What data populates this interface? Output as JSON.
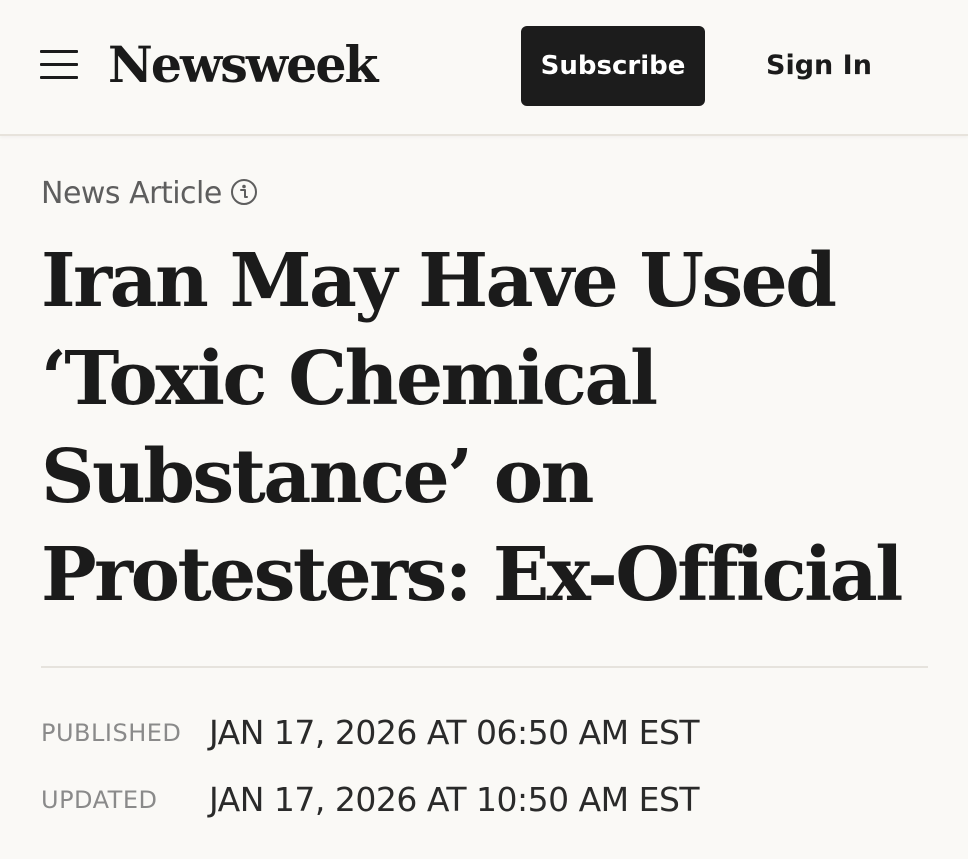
{
  "header": {
    "logo": "Newsweek",
    "subscribe_label": "Subscribe",
    "signin_label": "Sign In"
  },
  "article": {
    "kicker": "News Article",
    "headline_lines": [
      "Iran May Have Used",
      "‘Toxic Chemical",
      "Substance’ on",
      "Protesters: Ex-Official"
    ],
    "published_label": "PUBLISHED",
    "published_value": "JAN 17, 2026 AT 06:50 AM EST",
    "updated_label": "UPDATED",
    "updated_value": "JAN 17, 2026 AT 10:50 AM EST"
  },
  "icons": {
    "menu": "hamburger-menu-icon",
    "kicker_info": "info-circle-icon"
  },
  "colors": {
    "background": "#faf9f6",
    "text": "#1b1b1b",
    "button_bg": "#1c1c1c",
    "button_text": "#ffffff",
    "meta_label": "#8a8a8a",
    "kicker": "#5e5e5e"
  }
}
